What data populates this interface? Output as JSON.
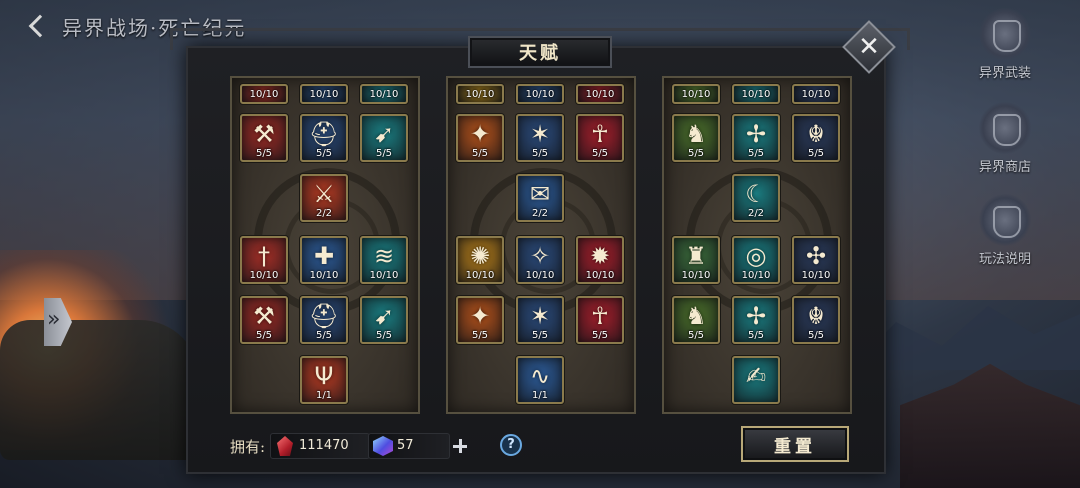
{
  "header": {
    "title": "异界战场·死亡纪元"
  },
  "dialog": {
    "title": "天赋",
    "close_glyph": "✕"
  },
  "side_menu": [
    {
      "label": "异界武装",
      "icon": "armor-icon"
    },
    {
      "label": "异界商店",
      "icon": "shop-icon"
    },
    {
      "label": "玩法说明",
      "icon": "book-icon"
    }
  ],
  "columns": [
    {
      "name": "column-left",
      "skills": [
        {
          "name": "skill-top-1",
          "glyph": "",
          "level": "10/10",
          "color": "#8a2a22",
          "partial": true
        },
        {
          "name": "skill-top-2",
          "glyph": "",
          "level": "10/10",
          "color": "#24446e",
          "partial": true
        },
        {
          "name": "skill-top-3",
          "glyph": "",
          "level": "10/10",
          "color": "#1a6e74",
          "partial": true
        },
        {
          "name": "axe-skill",
          "glyph": "⚒",
          "level": "5/5",
          "color": "#9a2a24"
        },
        {
          "name": "helmet-skill",
          "glyph": "⛑",
          "level": "5/5",
          "color": "#2a4a7a"
        },
        {
          "name": "runner-skill",
          "glyph": "➹",
          "level": "5/5",
          "color": "#1a7c80"
        },
        {
          "name": "sword-skill",
          "glyph": "⚔",
          "level": "2/2",
          "color": "#b43a22"
        },
        {
          "name": "dagger-skill",
          "glyph": "†",
          "level": "10/10",
          "color": "#a42e26"
        },
        {
          "name": "shield-skill",
          "glyph": "✚",
          "level": "10/10",
          "color": "#2c5a96"
        },
        {
          "name": "wing-skill",
          "glyph": "≋",
          "level": "10/10",
          "color": "#1a7c80"
        },
        {
          "name": "axe-skill-2",
          "glyph": "⚒",
          "level": "5/5",
          "color": "#9a2a24"
        },
        {
          "name": "helmet-skill-2",
          "glyph": "⛑",
          "level": "5/5",
          "color": "#2a4a7a"
        },
        {
          "name": "runner-skill-2",
          "glyph": "➹",
          "level": "5/5",
          "color": "#1a7c80"
        },
        {
          "name": "trident-skill",
          "glyph": "Ψ",
          "level": "1/1",
          "color": "#b43a22"
        }
      ]
    },
    {
      "name": "column-middle",
      "skills": [
        {
          "name": "skill-top-4",
          "glyph": "",
          "level": "10/10",
          "color": "#8a6a1a",
          "partial": true
        },
        {
          "name": "skill-top-5",
          "glyph": "",
          "level": "10/10",
          "color": "#24446e",
          "partial": true
        },
        {
          "name": "skill-top-6",
          "glyph": "",
          "level": "10/10",
          "color": "#8a1e26",
          "partial": true
        },
        {
          "name": "eagle-skill",
          "glyph": "✦",
          "level": "5/5",
          "color": "#b0501a"
        },
        {
          "name": "rune-skill",
          "glyph": "✶",
          "level": "5/5",
          "color": "#2a4a7a"
        },
        {
          "name": "ankh-skill",
          "glyph": "☥",
          "level": "5/5",
          "color": "#a21e2a"
        },
        {
          "name": "scroll-skill",
          "glyph": "✉",
          "level": "2/2",
          "color": "#2c5a96"
        },
        {
          "name": "spiral-skill",
          "glyph": "✺",
          "level": "10/10",
          "color": "#b07a1a"
        },
        {
          "name": "vortex-skill",
          "glyph": "✧",
          "level": "10/10",
          "color": "#2a4a7a"
        },
        {
          "name": "burst-skill",
          "glyph": "✹",
          "level": "10/10",
          "color": "#a21e2a"
        },
        {
          "name": "eagle-skill-2",
          "glyph": "✦",
          "level": "5/5",
          "color": "#b0501a"
        },
        {
          "name": "rune-skill-2",
          "glyph": "✶",
          "level": "5/5",
          "color": "#2a4a7a"
        },
        {
          "name": "ankh-skill-2",
          "glyph": "☥",
          "level": "5/5",
          "color": "#a21e2a"
        },
        {
          "name": "serpent-skill",
          "glyph": "∿",
          "level": "1/1",
          "color": "#2c5a96"
        }
      ]
    },
    {
      "name": "column-right",
      "skills": [
        {
          "name": "skill-top-7",
          "glyph": "",
          "level": "10/10",
          "color": "#4a6a2a",
          "partial": true
        },
        {
          "name": "skill-top-8",
          "glyph": "",
          "level": "10/10",
          "color": "#1a6e74",
          "partial": true
        },
        {
          "name": "skill-top-9",
          "glyph": "",
          "level": "10/10",
          "color": "#2a3a5a",
          "partial": true
        },
        {
          "name": "knight-skill",
          "glyph": "♞",
          "level": "5/5",
          "color": "#4a6e2a"
        },
        {
          "name": "wings-skill",
          "glyph": "✢",
          "level": "5/5",
          "color": "#1a7c80"
        },
        {
          "name": "amulet-skill",
          "glyph": "☬",
          "level": "5/5",
          "color": "#2a3a5a"
        },
        {
          "name": "moon-skill",
          "glyph": "☾",
          "level": "2/2",
          "color": "#1a7c80"
        },
        {
          "name": "boot-skill",
          "glyph": "♜",
          "level": "10/10",
          "color": "#3a6a3a"
        },
        {
          "name": "ring-skill",
          "glyph": "◎",
          "level": "10/10",
          "color": "#1a7c80"
        },
        {
          "name": "knot-skill",
          "glyph": "✣",
          "level": "10/10",
          "color": "#2a3a5a"
        },
        {
          "name": "knight-skill-2",
          "glyph": "♞",
          "level": "5/5",
          "color": "#4a6e2a"
        },
        {
          "name": "wings-skill-2",
          "glyph": "✢",
          "level": "5/5",
          "color": "#1a7c80"
        },
        {
          "name": "amulet-skill-2",
          "glyph": "☬",
          "level": "5/5",
          "color": "#2a3a5a"
        },
        {
          "name": "claw-skill",
          "glyph": "✍",
          "level": "",
          "color": "#1a7c80"
        }
      ]
    }
  ],
  "footer": {
    "own_label": "拥有:",
    "crystal_value": "111470",
    "cube_value": "57",
    "help_glyph": "?",
    "reset_label": "重置"
  }
}
